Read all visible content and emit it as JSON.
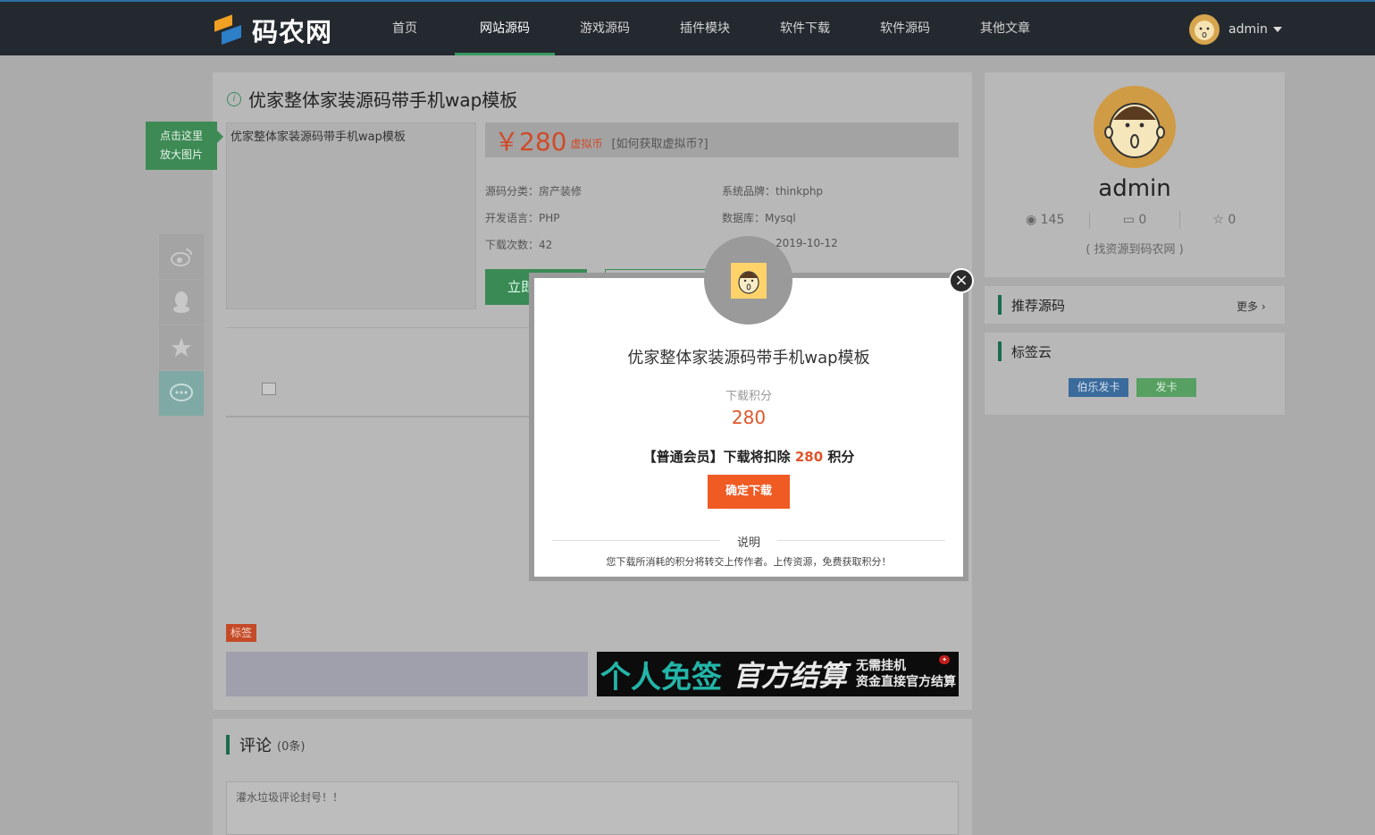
{
  "header": {
    "logo_text": "码农网",
    "nav": [
      "首页",
      "网站源码",
      "游戏源码",
      "插件模块",
      "软件下载",
      "软件源码",
      "其他文章"
    ],
    "active_nav": "网站源码",
    "user_name": "admin"
  },
  "product": {
    "title": "优家整体家装源码带手机wap模板",
    "zoom_tip_line1": "点击这里",
    "zoom_tip_line2": "放大图片",
    "image_alt": "优家整体家装源码带手机wap模板",
    "price": "￥280",
    "currency": "虚拟币",
    "howto": "[如何获取虚拟币?]",
    "category": "源码分类：房产装修",
    "brand": "系统品牌：thinkphp",
    "language": "开发语言：PHP",
    "database": "数据库：Mysql",
    "downloads": "下载次数：42",
    "date": "2019-10-12",
    "download_btn": "立即",
    "tag_badge": "标签"
  },
  "ad": {
    "big1": "个人免签",
    "big2": "官方结算",
    "small1": "无需挂机",
    "small2": "资金直接官方结算"
  },
  "comments": {
    "title": "评论",
    "count": "(0条)",
    "placeholder": "灌水垃圾评论封号！！"
  },
  "sidebar": {
    "username": "admin",
    "views": "145",
    "comments": "0",
    "favorites": "0",
    "slogan": "( 找资源到码农网 )",
    "recommend_title": "推荐源码",
    "more": "更多",
    "tagcloud_title": "标签云",
    "tags": [
      "伯乐发卡",
      "发卡"
    ]
  },
  "modal": {
    "title": "优家整体家装源码带手机wap模板",
    "points_label": "下载积分",
    "points": "280",
    "notice_prefix": "【普通会员】下载将扣除",
    "notice_points": "280",
    "notice_suffix": "积分",
    "confirm": "确定下载",
    "explain_title": "说明",
    "explain_text": "您下载所消耗的积分将转交上传作者。上传资源，免费获取积分！"
  },
  "colors": {
    "accent_green": "#3a8a55",
    "price_red": "#d04a28",
    "confirm_orange": "#f05a23",
    "nav_bg": "#24292f"
  }
}
